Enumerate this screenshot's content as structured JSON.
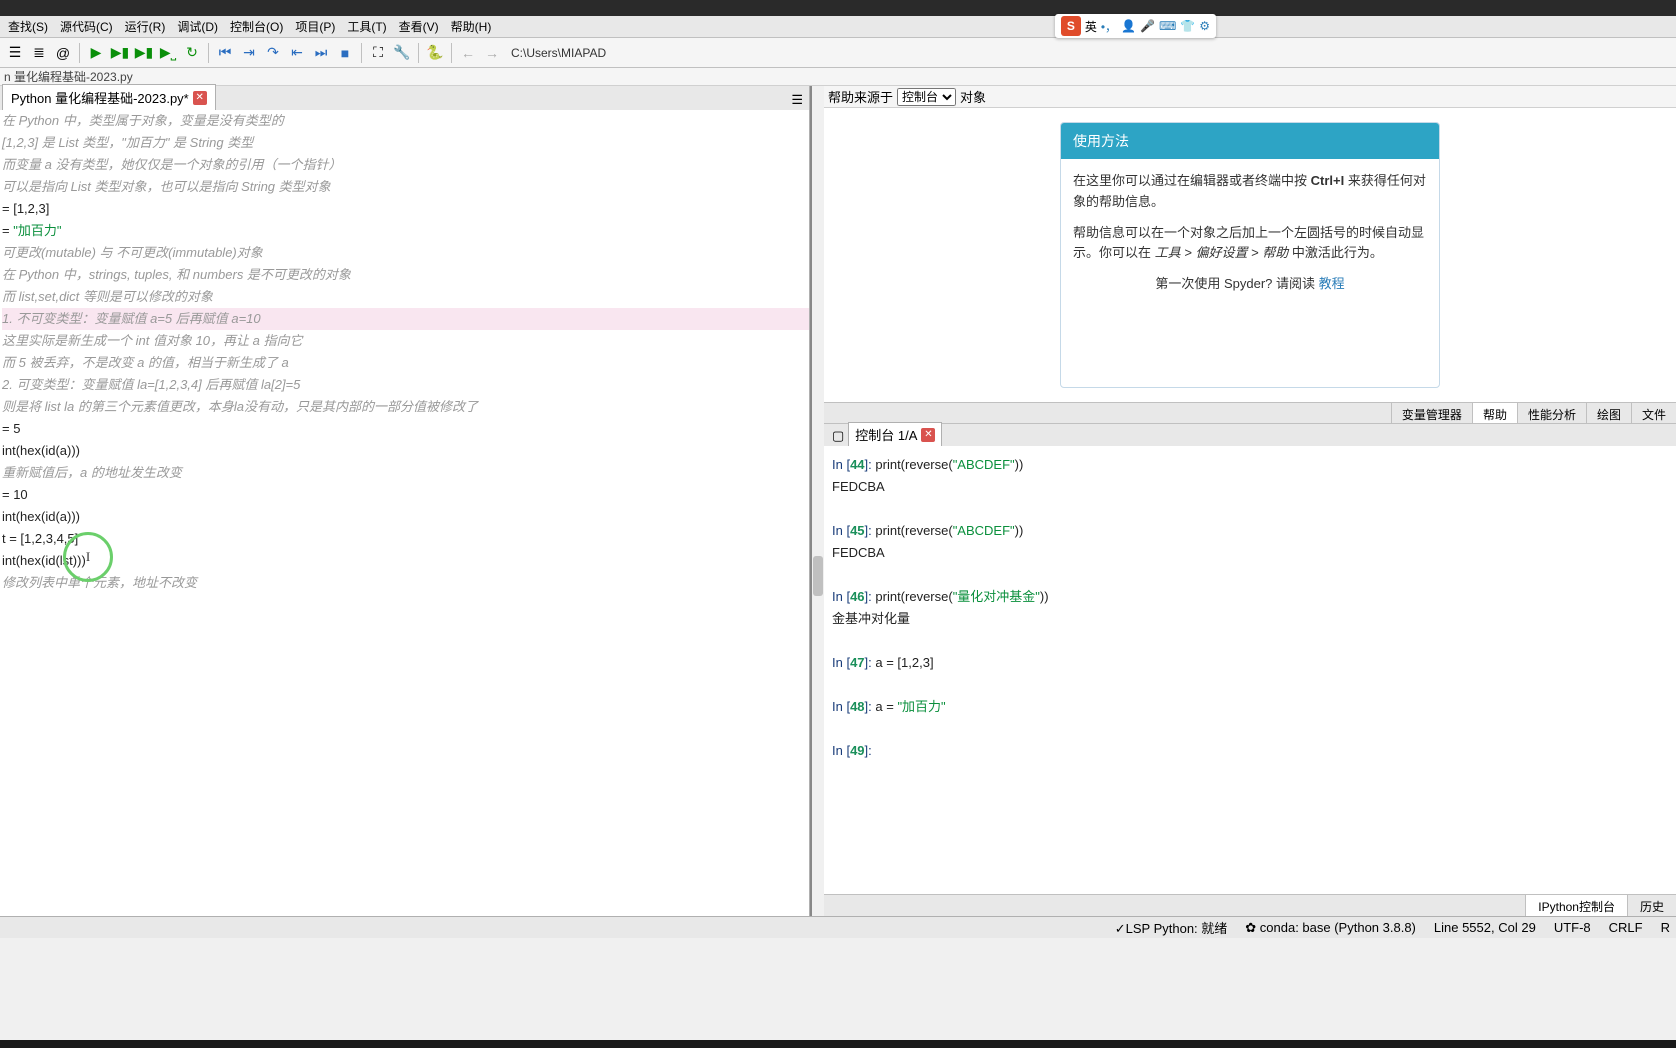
{
  "menu": [
    "查找(S)",
    "源代码(C)",
    "运行(R)",
    "调试(D)",
    "控制台(O)",
    "项目(P)",
    "工具(T)",
    "查看(V)",
    "帮助(H)"
  ],
  "breadcrumb": "n 量化编程基础-2023.py",
  "tab": {
    "label": "Python 量化编程基础-2023.py*"
  },
  "path": "C:\\Users\\MIAPAD",
  "editor_lines": [
    {
      "t": "在 Python 中，类型属于对象，变量是没有类型的",
      "c": ""
    },
    {
      "t": "",
      "c": ""
    },
    {
      "t": "[1,2,3] 是 List 类型，\"加百力\" 是 String 类型",
      "c": ""
    },
    {
      "t": "",
      "c": ""
    },
    {
      "t": "而变量 a 没有类型，她仅仅是一个对象的引用（一个指针）",
      "c": ""
    },
    {
      "t": "",
      "c": ""
    },
    {
      "t": "可以是指向 List 类型对象，也可以是指向 String 类型对象",
      "c": ""
    },
    {
      "t": "",
      "c": ""
    },
    {
      "t": "= [1,2,3]",
      "c": "code"
    },
    {
      "t": "",
      "c": ""
    },
    {
      "t": "= \"加百力\"",
      "c": "code str"
    },
    {
      "t": "",
      "c": ""
    },
    {
      "t": "",
      "c": ""
    },
    {
      "t": "",
      "c": ""
    },
    {
      "t": "可更改(mutable) 与 不可更改(immutable)对象",
      "c": ""
    },
    {
      "t": "",
      "c": ""
    },
    {
      "t": "在 Python 中，strings, tuples, 和 numbers 是不可更改的对象",
      "c": ""
    },
    {
      "t": "",
      "c": ""
    },
    {
      "t": "而 list,set,dict 等则是可以修改的对象",
      "c": ""
    },
    {
      "t": "",
      "c": ""
    },
    {
      "t": "",
      "c": ""
    },
    {
      "t": "",
      "c": ""
    },
    {
      "t": "1. 不可变类型：变量赋值 a=5 后再赋值 a=10",
      "c": "hl"
    },
    {
      "t": "",
      "c": ""
    },
    {
      "t": "这里实际是新生成一个 int 值对象 10，再让 a 指向它",
      "c": ""
    },
    {
      "t": "",
      "c": ""
    },
    {
      "t": "而 5 被丢弃，不是改变 a 的值，相当于新生成了 a",
      "c": ""
    },
    {
      "t": "",
      "c": ""
    },
    {
      "t": "",
      "c": ""
    },
    {
      "t": "2. 可变类型：变量赋值 la=[1,2,3,4] 后再赋值 la[2]=5",
      "c": ""
    },
    {
      "t": "",
      "c": ""
    },
    {
      "t": "则是将 list la 的第三个元素值更改，本身la没有动，只是其内部的一部分值被修改了",
      "c": ""
    },
    {
      "t": "",
      "c": ""
    },
    {
      "t": "= 5",
      "c": "code"
    },
    {
      "t": "int(hex(id(a)))",
      "c": "code"
    },
    {
      "t": "",
      "c": ""
    },
    {
      "t": "重新赋值后，a 的地址发生改变",
      "c": ""
    },
    {
      "t": "= 10",
      "c": "code"
    },
    {
      "t": "int(hex(id(a)))",
      "c": "code"
    },
    {
      "t": "",
      "c": ""
    },
    {
      "t": "",
      "c": ""
    },
    {
      "t": "",
      "c": ""
    },
    {
      "t": "t = [1,2,3,4,5]",
      "c": "code"
    },
    {
      "t": "int(hex(id(lst)))",
      "c": "code"
    },
    {
      "t": "",
      "c": ""
    },
    {
      "t": "修改列表中单个元素，地址不改变",
      "c": ""
    }
  ],
  "help": {
    "label_src": "帮助来源于",
    "select": "控制台",
    "label_obj": "对象",
    "card_title": "使用方法",
    "card_p1a": "在这里你可以通过在编辑器或者终端中按 ",
    "card_p1b": "Ctrl+I",
    "card_p1c": " 来获得任何对象的帮助信息。",
    "card_p2a": "帮助信息可以在一个对象之后加上一个左圆括号的时候自动显示。你可以在 ",
    "card_p2b": "工具 > 偏好设置 > 帮助",
    "card_p2c": " 中激活此行为。",
    "card_linka": "第一次使用 Spyder? 请阅读 ",
    "card_linkb": "教程"
  },
  "help_tabs": [
    "变量管理器",
    "帮助",
    "性能分析",
    "绘图",
    "文件"
  ],
  "console_tab": "控制台 1/A",
  "console_lines": [
    {
      "p": "44",
      "code": "print(reverse(",
      "s": "\"ABCDEF\"",
      "e": "))"
    },
    {
      "out": "FEDCBA"
    },
    {
      "blank": true
    },
    {
      "p": "45",
      "code": "print(reverse(",
      "s": "\"ABCDEF\"",
      "e": "))"
    },
    {
      "out": "FEDCBA"
    },
    {
      "blank": true
    },
    {
      "p": "46",
      "code": "print(reverse(",
      "s": "\"量化对冲基金\"",
      "e": "))"
    },
    {
      "out": "金基冲对化量"
    },
    {
      "blank": true
    },
    {
      "p": "47",
      "code": "a = [1,2,3]",
      "s": "",
      "e": ""
    },
    {
      "blank": true
    },
    {
      "p": "48",
      "code": "a = ",
      "s": "\"加百力\"",
      "e": ""
    },
    {
      "blank": true
    },
    {
      "p": "49",
      "code": "",
      "s": "",
      "e": ""
    }
  ],
  "console_bottom": [
    "IPython控制台",
    "历史"
  ],
  "status": {
    "lsp": "✓LSP Python: 就绪",
    "conda": "✿ conda: base (Python 3.8.8)",
    "line": "Line 5552, Col 29",
    "enc": "UTF-8",
    "eol": "CRLF",
    "rw": "R"
  },
  "ime": {
    "s": "S",
    "lang": "英"
  }
}
